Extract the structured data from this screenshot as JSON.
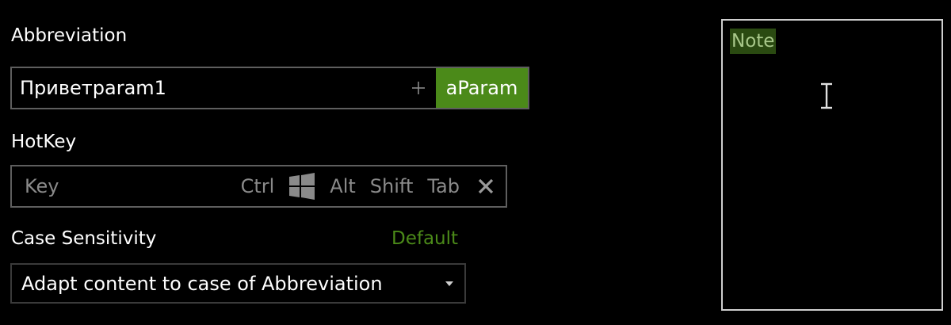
{
  "abbreviation": {
    "label": "Abbreviation",
    "value": "Приветparam1",
    "add_icon": "plus-icon",
    "param_button": "aParam"
  },
  "hotkey": {
    "label": "HotKey",
    "placeholder": "Key",
    "modifiers": {
      "ctrl": "Ctrl",
      "win_icon": "windows-icon",
      "alt": "Alt",
      "shift": "Shift",
      "tab": "Tab"
    },
    "clear_icon": "close-icon"
  },
  "case_sensitivity": {
    "label": "Case Sensitivity",
    "default_link": "Default",
    "selected": "Adapt content to case of Abbreviation"
  },
  "note": {
    "placeholder": "Note"
  },
  "colors": {
    "accent": "#4b8a19",
    "background": "#000000",
    "text": "#ffffff",
    "muted": "#8a8a8a",
    "border": "#5e5e5e",
    "note_border": "#cfcfcf",
    "note_highlight": "#2a4a11"
  }
}
